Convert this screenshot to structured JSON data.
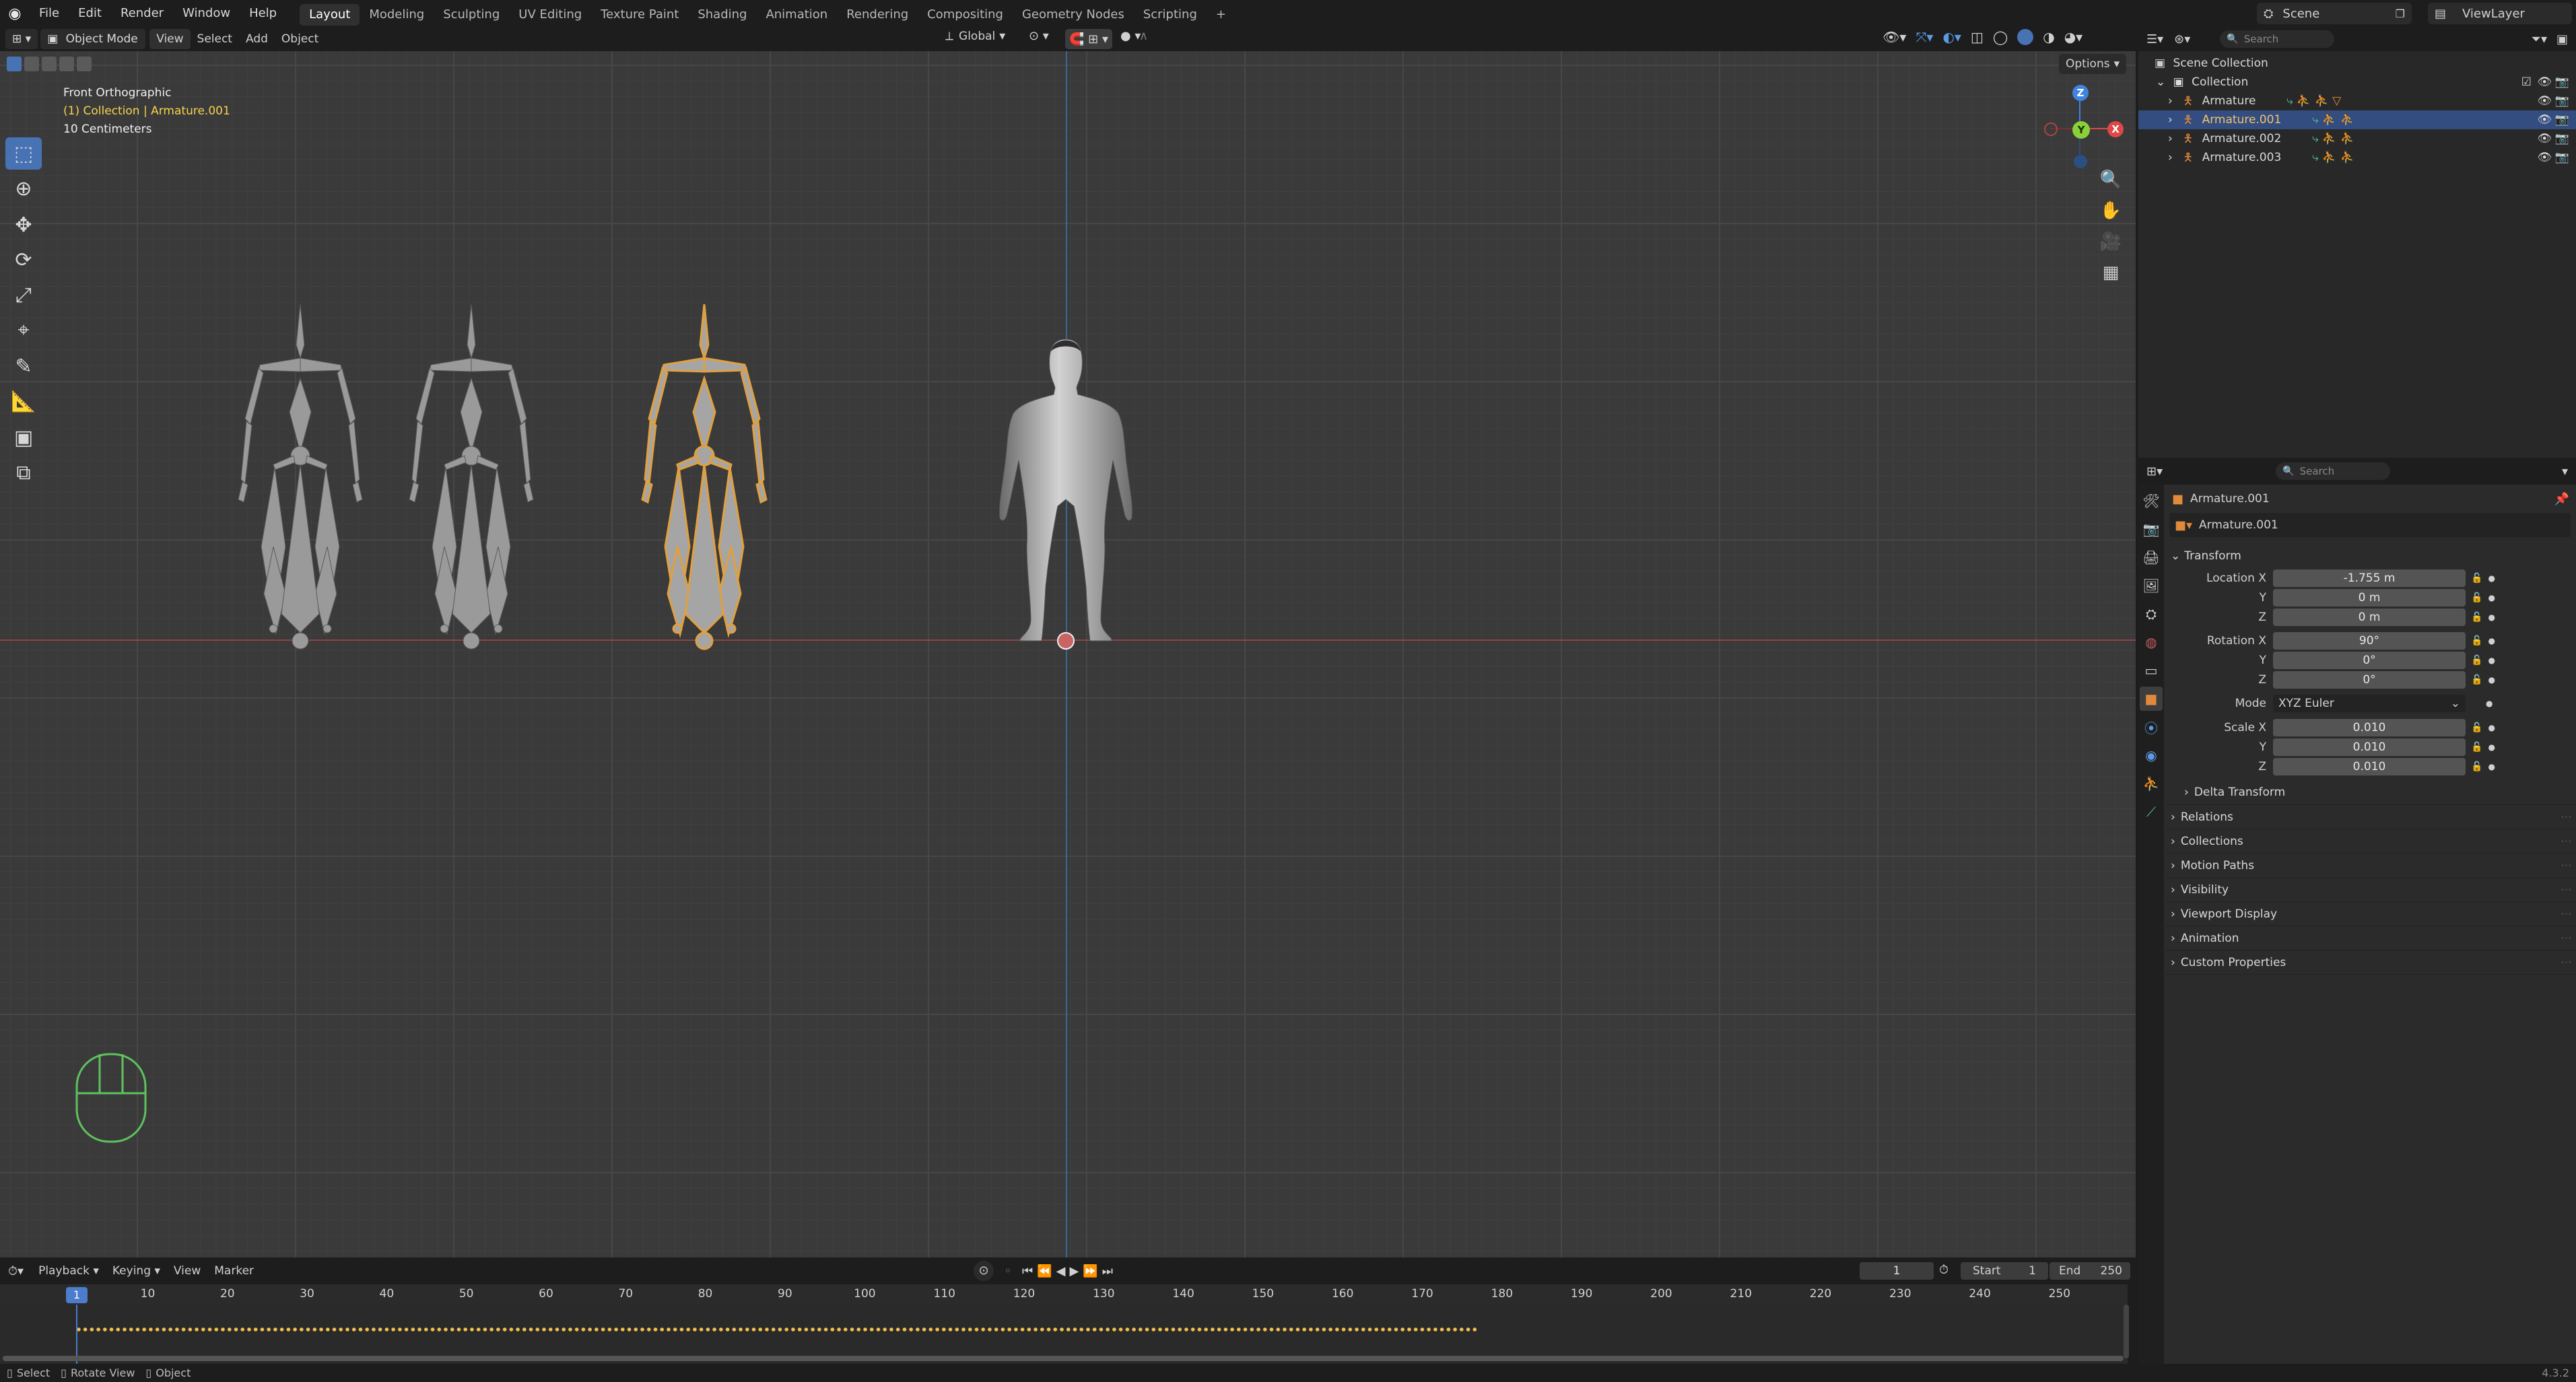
{
  "topbar": {
    "menus": [
      "File",
      "Edit",
      "Render",
      "Window",
      "Help"
    ],
    "workspaces": [
      "Layout",
      "Modeling",
      "Sculpting",
      "UV Editing",
      "Texture Paint",
      "Shading",
      "Animation",
      "Rendering",
      "Compositing",
      "Geometry Nodes",
      "Scripting"
    ],
    "active_workspace": "Layout",
    "add_tab": "+",
    "scene_label": "Scene",
    "viewlayer_label": "ViewLayer"
  },
  "viewport_header": {
    "mode": "Object Mode",
    "menus": [
      "View",
      "Select",
      "Add",
      "Object"
    ],
    "orientation": "Global",
    "options": "Options"
  },
  "viewport": {
    "view_name": "Front Orthographic",
    "collection_info": "(1) Collection | Armature.001",
    "scale": "10 Centimeters",
    "gizmo": {
      "z": "Z",
      "y": "Y",
      "x": "X"
    },
    "colors": {
      "selection": "#e0a040",
      "x_axis": "#e04848",
      "y_axis": "#8ad03a",
      "z_axis": "#3f84e0",
      "active_text": "#f7d44c"
    }
  },
  "toolbar": {
    "tools": [
      {
        "name": "select-box-icon",
        "active": true
      },
      {
        "name": "cursor-icon",
        "active": false
      },
      {
        "name": "move-icon",
        "active": false
      },
      {
        "name": "rotate-icon",
        "active": false
      },
      {
        "name": "scale-icon",
        "active": false
      },
      {
        "name": "transform-icon",
        "active": false
      },
      {
        "name": "annotate-icon",
        "active": false
      },
      {
        "name": "measure-icon",
        "active": false
      },
      {
        "name": "add-cube-icon",
        "active": false
      },
      {
        "name": "extrude-icon",
        "active": false
      }
    ]
  },
  "outliner": {
    "search_placeholder": "Search",
    "scene_collection": "Scene Collection",
    "collection": "Collection",
    "items": [
      {
        "label": "Armature",
        "selected": false
      },
      {
        "label": "Armature.001",
        "selected": true
      },
      {
        "label": "Armature.002",
        "selected": false
      },
      {
        "label": "Armature.003",
        "selected": false
      }
    ]
  },
  "properties": {
    "search_placeholder": "Search",
    "object_name": "Armature.001",
    "data_name": "Armature.001",
    "transform_label": "Transform",
    "location_label": "Location X",
    "location": {
      "x": "-1.755 m",
      "y": "0 m",
      "z": "0 m"
    },
    "rotation_label": "Rotation X",
    "rotation": {
      "x": "90°",
      "y": "0°",
      "z": "0°"
    },
    "mode_label": "Mode",
    "mode_value": "XYZ Euler",
    "scale_label": "Scale X",
    "scale": {
      "x": "0.010",
      "y": "0.010",
      "z": "0.010"
    },
    "axis_y": "Y",
    "axis_z": "Z",
    "delta_transform": "Delta Transform",
    "panels": [
      "Relations",
      "Collections",
      "Motion Paths",
      "Visibility",
      "Viewport Display",
      "Animation",
      "Custom Properties"
    ]
  },
  "timeline": {
    "menus": [
      "Playback",
      "Keying",
      "View",
      "Marker"
    ],
    "current_frame": "1",
    "start_label": "Start",
    "start": "1",
    "end_label": "End",
    "end": "250",
    "ruler": [
      "10",
      "20",
      "30",
      "40",
      "50",
      "60",
      "70",
      "80",
      "90",
      "100",
      "110",
      "120",
      "130",
      "140",
      "150",
      "160",
      "170",
      "180",
      "190",
      "200",
      "210",
      "220",
      "230",
      "240",
      "250"
    ],
    "playhead_label": "1"
  },
  "statusbar": {
    "select": "Select",
    "rotate": "Rotate View",
    "object": "Object",
    "version": "4.3.2"
  }
}
